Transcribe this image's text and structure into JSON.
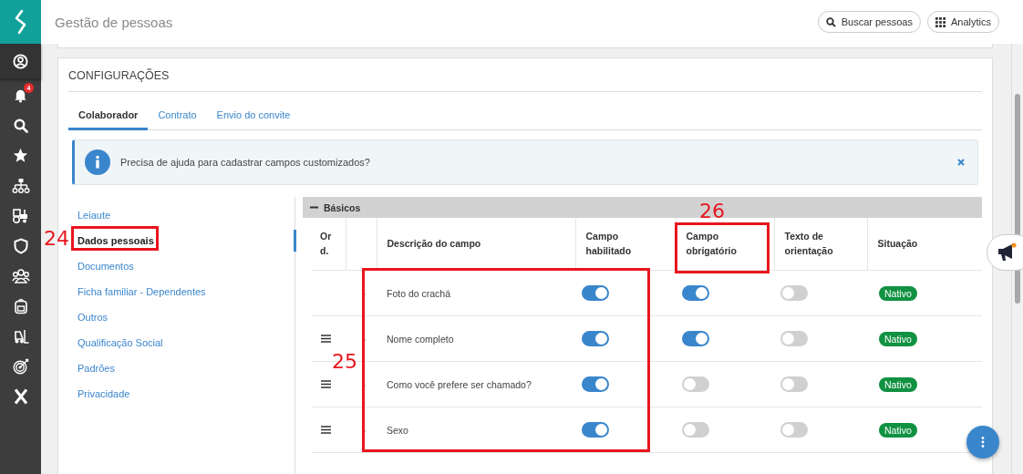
{
  "header": {
    "title": "Gestão de pessoas",
    "buttons": [
      {
        "kind": "search",
        "label": "Buscar pessoas"
      },
      {
        "kind": "grid",
        "label": "Analytics"
      }
    ]
  },
  "sidebar": {
    "notification_count": "4"
  },
  "settings": {
    "title": "CONFIGURAÇÕES",
    "tabs": [
      {
        "label": "Colaborador",
        "selected": true
      },
      {
        "label": "Contrato",
        "selected": false
      },
      {
        "label": "Envio do convite",
        "selected": false
      }
    ],
    "alert": {
      "text": "Precisa de ajuda para cadastrar campos customizados?"
    },
    "nav": [
      {
        "label": "Leiaute",
        "selected": false
      },
      {
        "label": "Dados pessoais",
        "selected": true
      },
      {
        "label": "Documentos",
        "selected": false
      },
      {
        "label": "Ficha familiar - Dependentes",
        "selected": false
      },
      {
        "label": "Outros",
        "selected": false
      },
      {
        "label": "Qualificação Social",
        "selected": false
      },
      {
        "label": "Padrões",
        "selected": false
      },
      {
        "label": "Privacidade",
        "selected": false
      }
    ],
    "section": {
      "title": "Básicos",
      "expanded": true
    },
    "columns": [
      "Ord.",
      "Descrição do campo",
      "Campo habilitado",
      "Campo obrigatório",
      "Texto de orientação",
      "Situação"
    ],
    "rows": [
      {
        "draggable": false,
        "description": "Foto do crachá",
        "enabled": true,
        "required": true,
        "guidance": false,
        "status": "Nativo"
      },
      {
        "draggable": true,
        "description": "Nome completo",
        "enabled": true,
        "required": true,
        "guidance": false,
        "status": "Nativo"
      },
      {
        "draggable": true,
        "description": "Como você prefere ser chamado?",
        "enabled": true,
        "required": false,
        "guidance": false,
        "status": "Nativo"
      },
      {
        "draggable": true,
        "description": "Sexo",
        "enabled": true,
        "required": false,
        "guidance": false,
        "status": "Nativo"
      }
    ]
  },
  "annotations": [
    {
      "label": "24"
    },
    {
      "label": "25"
    },
    {
      "label": "26"
    }
  ]
}
